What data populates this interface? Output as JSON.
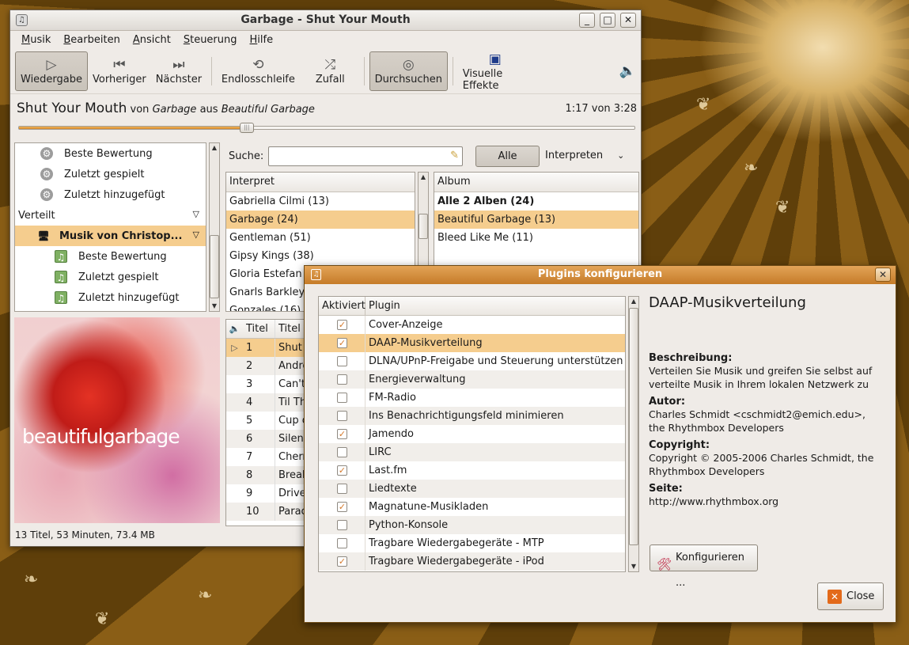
{
  "window": {
    "title": "Garbage - Shut Your Mouth",
    "min": "_",
    "max": "□",
    "close": "✕"
  },
  "menu": [
    "Musik",
    "Bearbeiten",
    "Ansicht",
    "Steuerung",
    "Hilfe"
  ],
  "toolbar": {
    "play": "Wiedergabe",
    "prev": "Vorheriger",
    "next": "Nächster",
    "repeat": "Endlosschleife",
    "shuffle": "Zufall",
    "browse": "Durchsuchen",
    "visual": "Visuelle Effekte"
  },
  "now_playing": {
    "title": "Shut Your Mouth",
    "von": "von",
    "artist": "Garbage",
    "aus": "aus",
    "album": "Beautiful Garbage",
    "time": "1:17 von 3:28",
    "progress": 0.37
  },
  "sidebar": {
    "items": [
      "Beste Bewertung",
      "Zuletzt gespielt",
      "Zuletzt hinzugefügt"
    ],
    "section": "Verteilt",
    "share": "Musik von Christop...",
    "share_items": [
      "Beste Bewertung",
      "Zuletzt gespielt",
      "Zuletzt hinzugefügt"
    ]
  },
  "album_art": {
    "text": "beautifulgarbage"
  },
  "search": {
    "label": "Suche:",
    "all_button": "Alle",
    "filter": "Interpreten"
  },
  "artists": {
    "header": "Interpret",
    "rows": [
      "Gabriella Cilmi (13)",
      "Garbage (24)",
      "Gentleman (51)",
      "Gipsy Kings (38)",
      "Gloria Estefan",
      "Gnarls Barkley",
      "Gonzales (16)"
    ]
  },
  "albums": {
    "header": "Album",
    "rows": [
      "Alle 2 Alben (24)",
      "Beautiful Garbage (13)",
      "Bleed Like Me (11)"
    ]
  },
  "tracks": {
    "header_num": "Titel",
    "header_title": "Titel",
    "rows": [
      {
        "n": "1",
        "t": "Shut"
      },
      {
        "n": "2",
        "t": "Andro"
      },
      {
        "n": "3",
        "t": "Can't"
      },
      {
        "n": "4",
        "t": "Til Th"
      },
      {
        "n": "5",
        "t": "Cup o"
      },
      {
        "n": "6",
        "t": "Silenc"
      },
      {
        "n": "7",
        "t": "Cherr"
      },
      {
        "n": "8",
        "t": "Break"
      },
      {
        "n": "9",
        "t": "Drive"
      },
      {
        "n": "10",
        "t": "Parac"
      }
    ]
  },
  "status": "13 Titel, 53 Minuten, 73.4 MB",
  "dialog": {
    "title": "Plugins konfigurieren",
    "col_active": "Aktiviert",
    "col_plugin": "Plugin",
    "plugins": [
      {
        "name": "Cover-Anzeige",
        "on": true
      },
      {
        "name": "DAAP-Musikverteilung",
        "on": true
      },
      {
        "name": "DLNA/UPnP-Freigabe und Steuerung unterstützen",
        "on": false
      },
      {
        "name": "Energieverwaltung",
        "on": false
      },
      {
        "name": "FM-Radio",
        "on": false
      },
      {
        "name": "Ins Benachrichtigungsfeld minimieren",
        "on": false
      },
      {
        "name": "Jamendo",
        "on": true
      },
      {
        "name": "LIRC",
        "on": false
      },
      {
        "name": "Last.fm",
        "on": true
      },
      {
        "name": "Liedtexte",
        "on": false
      },
      {
        "name": "Magnatune-Musikladen",
        "on": true
      },
      {
        "name": "Python-Konsole",
        "on": false
      },
      {
        "name": "Tragbare Wiedergabegeräte - MTP",
        "on": false
      },
      {
        "name": "Tragbare Wiedergabegeräte - iPod",
        "on": true
      }
    ],
    "info": {
      "name": "DAAP-Musikverteilung",
      "desc_label": "Beschreibung:",
      "desc": "Verteilen Sie Musik und greifen Sie selbst auf verteilte Musik in Ihrem lokalen Netzwerk zu",
      "author_label": "Autor:",
      "author": "Charles Schmidt <cschmidt2@emich.edu>, the Rhythmbox Developers",
      "copyright_label": "Copyright:",
      "copyright": "Copyright © 2005-2006 Charles Schmidt, the Rhythmbox Developers",
      "site_label": "Seite:",
      "site": "http://www.rhythmbox.org"
    },
    "configure": "Konfigurieren ...",
    "close": "Close",
    "check": "✓"
  }
}
